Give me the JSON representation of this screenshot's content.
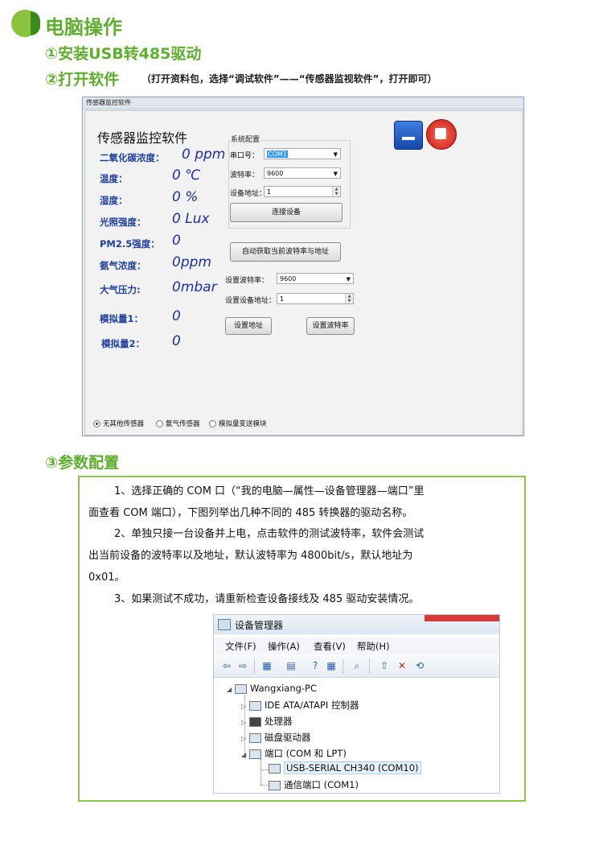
{
  "header": {
    "title": "电脑操作",
    "step1": "①安装USB转485驱动",
    "step2": "②打开软件",
    "step2_note": "（打开资料包，选择“调试软件”——“传感器监视软件”，打开即可）",
    "step3": "③参数配置"
  },
  "software": {
    "window_title": "传感器监控软件",
    "heading": "传感器监控软件",
    "readings": [
      {
        "label": "二氧化碳浓度：",
        "value": "0 ppm"
      },
      {
        "label": "温度：",
        "value": "0 ℃"
      },
      {
        "label": "湿度：",
        "value": "0 %"
      },
      {
        "label": "光照强度：",
        "value": "0 Lux"
      },
      {
        "label": "PM2.5强度：",
        "value": "0"
      },
      {
        "label": "氨气浓度：",
        "value": "0ppm"
      },
      {
        "label": "大气压力:",
        "value": "0mbar"
      },
      {
        "label": "模拟量1：",
        "value": "0"
      },
      {
        "label": "模拟量2：",
        "value": "0"
      }
    ],
    "sys_config": {
      "group_title": "系统配置",
      "port_label": "串口号：",
      "port_value": "COM1",
      "baud_label": "波特率：",
      "baud_value": "9600",
      "addr_label": "设备地址：",
      "addr_value": "1",
      "connect_button": "连接设备"
    },
    "auto_button": "自动获取当前波特率与地址",
    "set_baud_label": "设置波特率：",
    "set_baud_value": "9600",
    "set_addr_label": "设置设备地址：",
    "set_addr_value": "1",
    "set_addr_button": "设置地址",
    "set_baud_button": "设置波特率",
    "radios": [
      {
        "label": "无其他传感器",
        "checked": true
      },
      {
        "label": "氨气传感器",
        "checked": false
      },
      {
        "label": "模拟量变送模块",
        "checked": false
      }
    ]
  },
  "instructions": {
    "p1_line1": "1、选择正确的 COM 口（“我的电脑—属性—设备管理器—端口”里",
    "p1_line2": "面查看 COM 端口），下图列举出几种不同的 485 转换器的驱动名称。",
    "p2_line1": "2、单独只接一台设备并上电，点击软件的测试波特率，软件会测试",
    "p2_line2": "出当前设备的波特率以及地址，默认波特率为 4800bit/s，默认地址为",
    "p2_line3": "0x01。",
    "p3_line1": "3、如果测试不成功，请重新检查设备接线及 485 驱动安装情况。"
  },
  "device_manager": {
    "title": "设备管理器",
    "menu": [
      "文件(F)",
      "操作(A)",
      "查看(V)",
      "帮助(H)"
    ],
    "tree": {
      "root": "Wangxiang-PC",
      "ide": "IDE ATA/ATAPI 控制器",
      "cpu": "处理器",
      "disk": "磁盘驱动器",
      "ports": "端口 (COM 和 LPT)",
      "usb_serial": "USB-SERIAL CH340 (COM10)",
      "com1": "通信端口 (COM1)"
    }
  },
  "colors": {
    "accent_green": "#5fae2e",
    "box_border": "#8cc54a",
    "reading_blue": "#1b2fa8"
  }
}
